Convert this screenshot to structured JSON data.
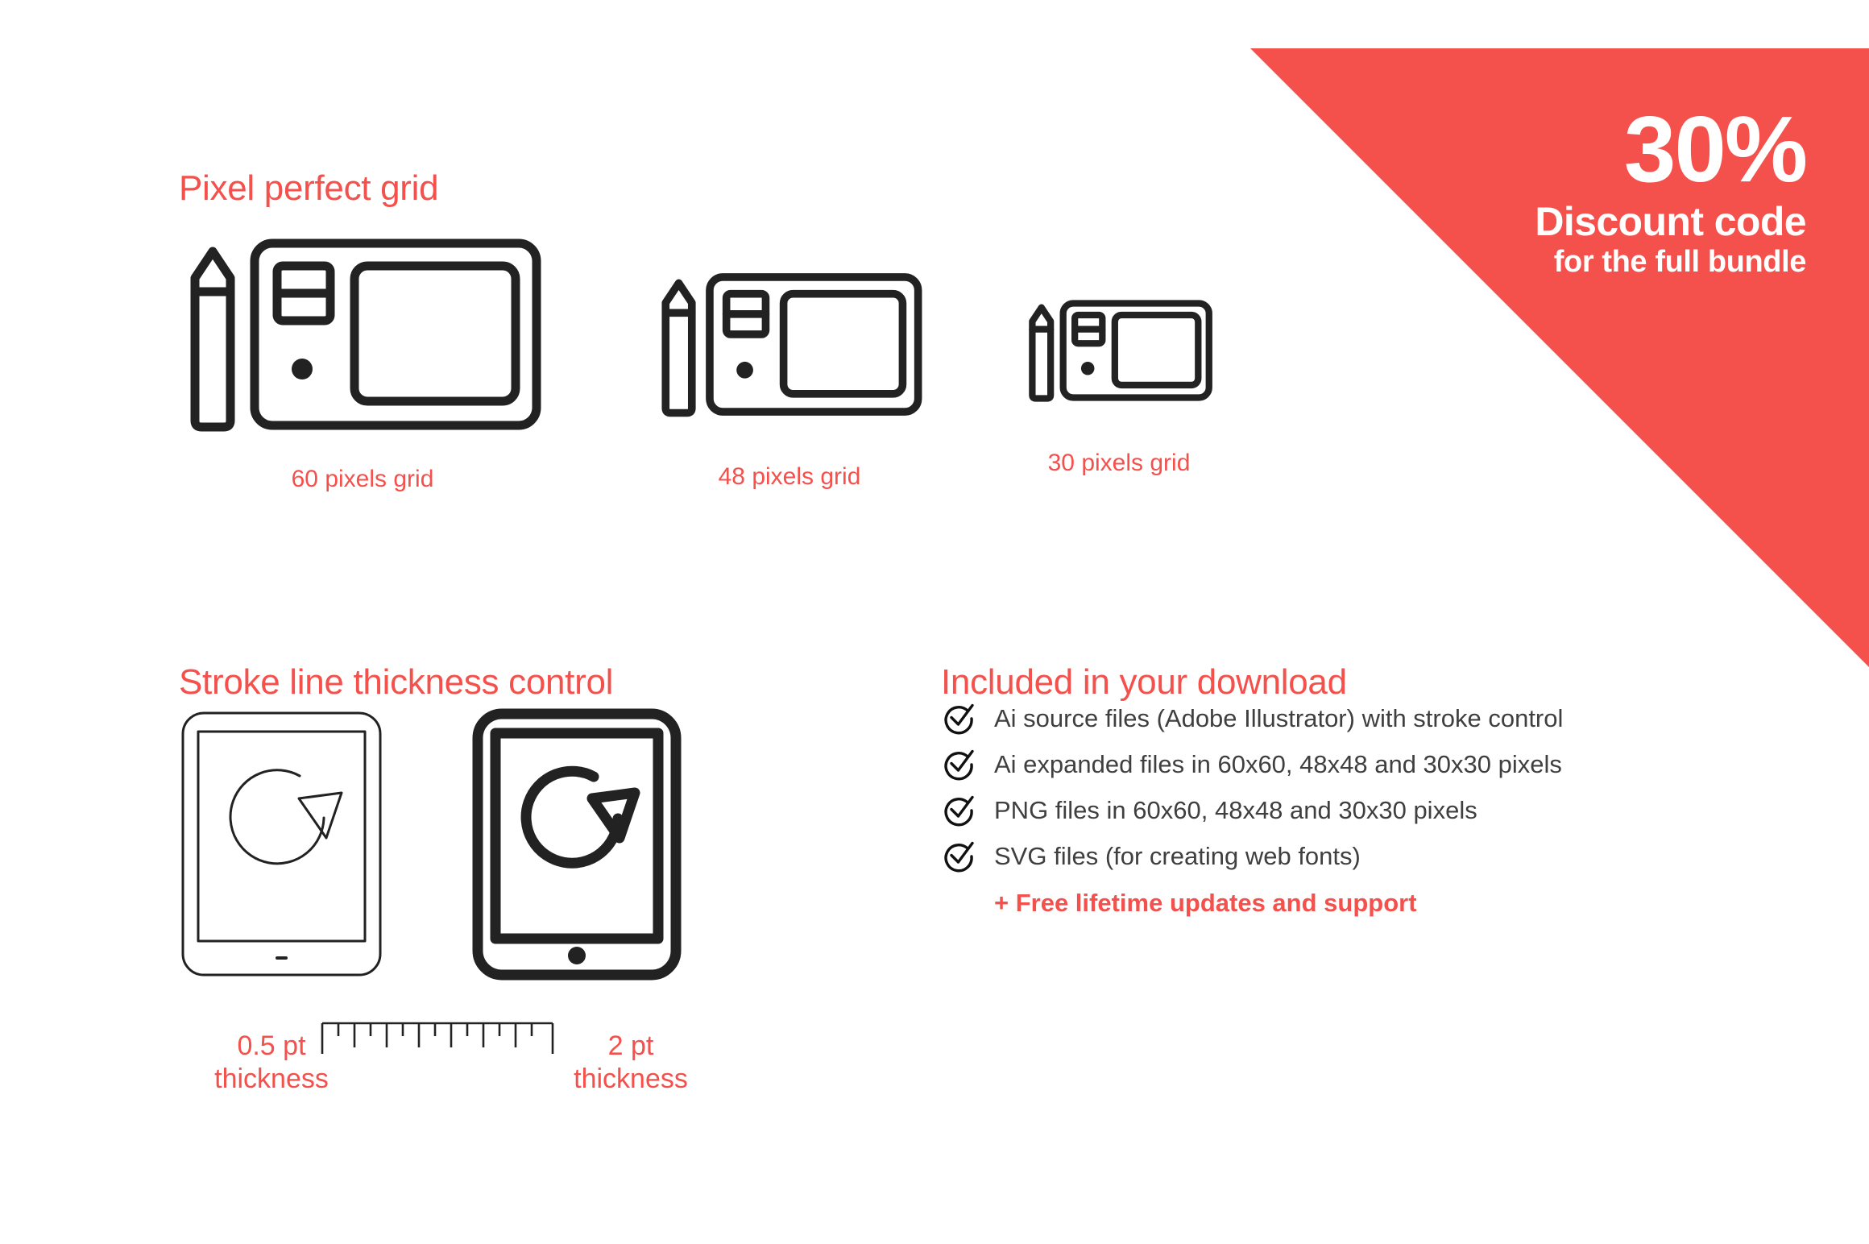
{
  "colors": {
    "accent_red": "#F4504C",
    "ink_black": "#222222",
    "body_gray": "#3F3F3F",
    "background": "#FFFFFF"
  },
  "promo_banner": {
    "percent": "30%",
    "line1": "Discount code",
    "line2": "for the full bundle",
    "background_color": "#F4504C",
    "text_color": "#FFFFFF"
  },
  "pixel_grid_section": {
    "heading": "Pixel perfect grid",
    "items": [
      {
        "caption": "60 pixels grid",
        "icon": "graphics-tablet-icon"
      },
      {
        "caption": "48 pixels grid",
        "icon": "graphics-tablet-icon"
      },
      {
        "caption": "30 pixels grid",
        "icon": "graphics-tablet-icon"
      }
    ]
  },
  "stroke_section": {
    "heading": "Stroke line thickness control",
    "left_label_line1": "0.5 pt",
    "left_label_line2": "thickness",
    "right_label_line1": "2 pt",
    "right_label_line2": "thickness",
    "left_icon": "tablet-rotate-thin-icon",
    "right_icon": "tablet-rotate-thick-icon",
    "ruler_icon": "ruler-icon"
  },
  "included_section": {
    "heading": "Included in your download",
    "items": [
      "Ai source files (Adobe Illustrator) with stroke control",
      "Ai expanded files in 60x60, 48x48 and 30x30 pixels",
      "PNG files in 60x60, 48x48 and 30x30 pixels",
      "SVG files (for creating web fonts)"
    ],
    "bonus": "+ Free lifetime updates and support",
    "bullet_icon": "check-circle-icon"
  }
}
